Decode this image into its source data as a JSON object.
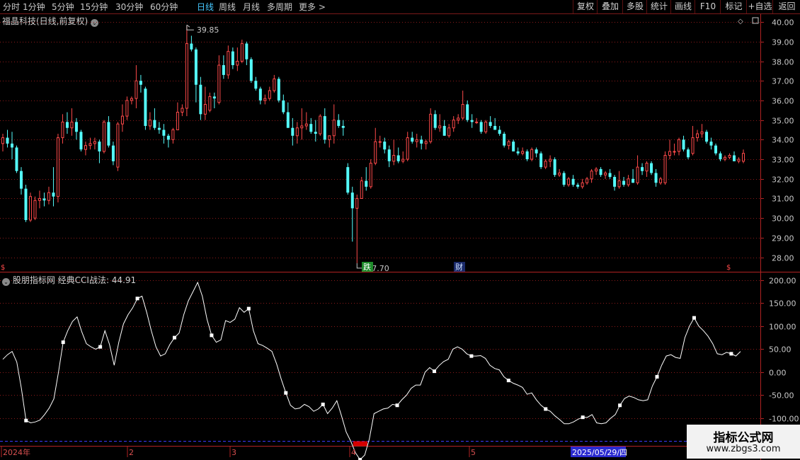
{
  "toolbar": {
    "periods": [
      "分时",
      "1分钟",
      "5分钟",
      "15分钟",
      "30分钟",
      "60分钟",
      "日线",
      "周线",
      "月线",
      "多周期",
      "更多 >"
    ],
    "active_period": "日线",
    "right_buttons": [
      "复权",
      "叠加",
      "多股",
      "统计",
      "画线",
      "F10",
      "标记",
      "+自选",
      "返回"
    ]
  },
  "main": {
    "title": "福晶科技(日线,前复权)",
    "y_ticks": [
      "40.00",
      "39.00",
      "38.00",
      "37.00",
      "36.00",
      "35.00",
      "34.00",
      "33.00",
      "32.00",
      "31.00",
      "30.00",
      "29.00",
      "28.00"
    ],
    "high_label": "39.85",
    "low_label": "27.70",
    "markers": {
      "die": "跌",
      "cai": "财"
    }
  },
  "indicator": {
    "title": "股朋指标网 经典CCI战法: 44.91",
    "y_ticks": [
      "200.00",
      "150.00",
      "100.00",
      "50.00",
      "0.00",
      "-50.00",
      "-100.00"
    ]
  },
  "xaxis": {
    "labels": [
      "2024年",
      "2",
      "3",
      "4",
      "5"
    ],
    "cursor_date": "2025/05/29/四"
  },
  "watermark": {
    "line1": "指标公式网",
    "line2": "www.zbgs3.com"
  },
  "colors": {
    "up": "#ff4a4a",
    "down": "#54fcfc",
    "grid": "#8b1a1a",
    "frame": "#b22222",
    "cci": "#ffffff",
    "signal": "#d40000",
    "ref": "#3a3aff"
  },
  "chart_data": [
    {
      "type": "candlestick",
      "title": "福晶科技(日线,前复权)",
      "ylim": [
        27.3,
        40.4
      ],
      "max_label": 39.85,
      "min_label": 27.7,
      "ohlc": [
        [
          33.8,
          34.3,
          33.4,
          34.1
        ],
        [
          34.1,
          34.5,
          33.6,
          33.8
        ],
        [
          33.8,
          34.4,
          33.0,
          33.6
        ],
        [
          33.6,
          33.7,
          32.3,
          32.4
        ],
        [
          32.4,
          32.6,
          31.2,
          31.5
        ],
        [
          31.5,
          31.7,
          29.8,
          29.9
        ],
        [
          29.9,
          31.3,
          29.8,
          31.1
        ],
        [
          30.0,
          31.1,
          29.9,
          30.9
        ],
        [
          30.9,
          31.4,
          30.5,
          31.0
        ],
        [
          31.0,
          31.3,
          30.6,
          30.9
        ],
        [
          30.9,
          31.6,
          30.7,
          31.3
        ],
        [
          31.3,
          32.6,
          30.6,
          31.1
        ],
        [
          31.1,
          34.3,
          30.8,
          34.1
        ],
        [
          34.1,
          35.3,
          33.8,
          34.9
        ],
        [
          34.9,
          35.4,
          34.3,
          34.6
        ],
        [
          34.6,
          35.6,
          34.2,
          34.9
        ],
        [
          34.9,
          35.1,
          34.0,
          34.4
        ],
        [
          34.4,
          34.5,
          33.4,
          33.5
        ],
        [
          33.5,
          33.9,
          33.2,
          33.7
        ],
        [
          33.7,
          34.1,
          33.5,
          33.8
        ],
        [
          33.8,
          34.1,
          33.5,
          33.9
        ],
        [
          33.9,
          34.0,
          32.8,
          33.4
        ],
        [
          33.4,
          35.0,
          33.3,
          34.9
        ],
        [
          34.9,
          35.2,
          33.6,
          33.7
        ],
        [
          33.7,
          33.9,
          32.7,
          32.9
        ],
        [
          32.6,
          34.9,
          32.4,
          34.8
        ],
        [
          34.8,
          35.8,
          34.4,
          35.2
        ],
        [
          35.2,
          36.2,
          35.0,
          36.0
        ],
        [
          36.0,
          36.2,
          35.8,
          36.1
        ],
        [
          36.1,
          37.8,
          35.6,
          37.0
        ],
        [
          37.0,
          37.3,
          36.4,
          36.8
        ],
        [
          36.6,
          36.7,
          34.5,
          34.7
        ],
        [
          34.7,
          35.4,
          34.5,
          35.0
        ],
        [
          35.0,
          35.6,
          34.5,
          34.6
        ],
        [
          34.6,
          34.9,
          34.3,
          34.5
        ],
        [
          34.5,
          34.8,
          33.8,
          34.2
        ],
        [
          34.2,
          34.3,
          33.6,
          34.0
        ],
        [
          34.0,
          34.6,
          33.8,
          34.5
        ],
        [
          34.5,
          35.9,
          34.5,
          35.4
        ],
        [
          35.4,
          35.8,
          35.2,
          35.6
        ],
        [
          35.6,
          39.8,
          35.2,
          38.9
        ],
        [
          38.9,
          39.3,
          38.5,
          38.6
        ],
        [
          38.6,
          38.7,
          35.9,
          36.8
        ],
        [
          36.8,
          37.2,
          35.0,
          35.3
        ],
        [
          35.3,
          36.7,
          35.0,
          35.8
        ],
        [
          35.5,
          36.4,
          35.4,
          36.2
        ],
        [
          36.2,
          36.4,
          35.6,
          36.1
        ],
        [
          35.9,
          38.3,
          35.8,
          37.8
        ],
        [
          37.8,
          38.3,
          37.1,
          37.3
        ],
        [
          37.3,
          38.8,
          37.1,
          38.5
        ],
        [
          38.5,
          38.7,
          37.6,
          37.8
        ],
        [
          37.8,
          38.7,
          37.5,
          38.0
        ],
        [
          38.0,
          39.1,
          37.9,
          38.9
        ],
        [
          38.9,
          39.0,
          37.8,
          38.1
        ],
        [
          38.1,
          38.2,
          36.9,
          37.0
        ],
        [
          37.0,
          37.2,
          36.5,
          36.6
        ],
        [
          36.6,
          36.7,
          35.8,
          36.0
        ],
        [
          36.0,
          36.3,
          35.8,
          36.1
        ],
        [
          36.1,
          36.7,
          36.0,
          36.5
        ],
        [
          36.5,
          37.3,
          36.4,
          37.1
        ],
        [
          37.1,
          37.2,
          35.9,
          36.0
        ],
        [
          36.0,
          36.3,
          35.3,
          35.4
        ],
        [
          35.4,
          35.9,
          34.6,
          34.6
        ],
        [
          34.6,
          35.1,
          33.7,
          34.2
        ],
        [
          34.2,
          34.9,
          33.8,
          34.6
        ],
        [
          34.6,
          35.6,
          34.0,
          34.7
        ],
        [
          34.7,
          35.4,
          34.5,
          34.8
        ],
        [
          34.8,
          35.1,
          34.3,
          34.4
        ],
        [
          34.4,
          35.0,
          33.9,
          34.3
        ],
        [
          34.3,
          35.3,
          34.2,
          35.2
        ],
        [
          35.2,
          35.6,
          33.8,
          34.0
        ],
        [
          34.0,
          34.1,
          33.6,
          34.2
        ],
        [
          34.2,
          35.8,
          33.8,
          35.0
        ],
        [
          35.0,
          35.3,
          34.6,
          34.7
        ],
        [
          34.7,
          35.0,
          34.2,
          34.6
        ],
        [
          32.6,
          32.8,
          31.2,
          31.3
        ],
        [
          31.3,
          31.6,
          28.8,
          30.5
        ],
        [
          30.5,
          31.2,
          27.7,
          31.0
        ],
        [
          31.0,
          32.1,
          31.0,
          31.9
        ],
        [
          31.9,
          32.6,
          31.4,
          31.6
        ],
        [
          31.6,
          33.0,
          31.5,
          32.8
        ],
        [
          32.8,
          34.6,
          32.7,
          33.9
        ],
        [
          33.9,
          34.2,
          33.6,
          33.9
        ],
        [
          33.9,
          34.1,
          33.3,
          33.5
        ],
        [
          33.5,
          33.7,
          32.6,
          32.9
        ],
        [
          32.9,
          34.0,
          32.7,
          33.2
        ],
        [
          33.2,
          33.6,
          32.8,
          32.9
        ],
        [
          32.9,
          33.4,
          32.8,
          33.0
        ],
        [
          33.0,
          34.4,
          32.9,
          34.1
        ],
        [
          34.1,
          34.4,
          33.8,
          33.9
        ],
        [
          33.9,
          34.3,
          33.6,
          34.0
        ],
        [
          34.0,
          34.2,
          33.5,
          33.8
        ],
        [
          33.8,
          34.0,
          33.5,
          33.9
        ],
        [
          33.9,
          35.6,
          33.8,
          35.3
        ],
        [
          35.3,
          35.5,
          34.5,
          34.6
        ],
        [
          34.6,
          35.3,
          34.4,
          34.7
        ],
        [
          34.7,
          35.0,
          34.2,
          34.2
        ],
        [
          34.2,
          34.8,
          34.1,
          34.6
        ],
        [
          34.6,
          35.2,
          34.4,
          35.0
        ],
        [
          35.0,
          35.3,
          34.8,
          35.1
        ],
        [
          35.1,
          36.5,
          35.0,
          35.8
        ],
        [
          35.8,
          36.0,
          34.9,
          35.0
        ],
        [
          35.0,
          35.3,
          34.6,
          34.9
        ],
        [
          34.9,
          35.1,
          34.8,
          34.9
        ],
        [
          34.9,
          35.0,
          34.3,
          34.4
        ],
        [
          34.4,
          35.0,
          34.3,
          34.9
        ],
        [
          34.9,
          35.2,
          34.6,
          34.7
        ],
        [
          34.7,
          35.1,
          34.5,
          34.5
        ],
        [
          34.5,
          34.7,
          34.2,
          34.3
        ],
        [
          34.3,
          34.4,
          33.6,
          33.7
        ],
        [
          33.7,
          34.0,
          33.5,
          33.9
        ],
        [
          33.9,
          34.0,
          33.4,
          33.4
        ],
        [
          33.4,
          33.6,
          33.2,
          33.3
        ],
        [
          33.3,
          33.6,
          33.2,
          33.4
        ],
        [
          33.4,
          33.5,
          32.9,
          33.0
        ],
        [
          33.0,
          33.6,
          32.9,
          33.5
        ],
        [
          33.5,
          33.6,
          33.1,
          33.3
        ],
        [
          33.3,
          33.4,
          32.5,
          32.6
        ],
        [
          32.6,
          33.0,
          32.5,
          32.9
        ],
        [
          32.9,
          33.2,
          32.6,
          33.0
        ],
        [
          33.0,
          33.1,
          32.1,
          32.2
        ],
        [
          32.2,
          32.5,
          32.1,
          32.3
        ],
        [
          32.3,
          32.4,
          31.6,
          31.7
        ],
        [
          31.7,
          32.1,
          31.6,
          32.0
        ],
        [
          32.0,
          32.2,
          31.6,
          31.7
        ],
        [
          31.7,
          31.8,
          31.5,
          31.6
        ],
        [
          31.6,
          32.0,
          31.5,
          31.8
        ],
        [
          31.8,
          32.1,
          31.7,
          32.0
        ],
        [
          32.0,
          32.5,
          31.8,
          32.4
        ],
        [
          32.4,
          32.6,
          32.2,
          32.5
        ],
        [
          32.5,
          32.6,
          32.1,
          32.2
        ],
        [
          32.2,
          32.4,
          32.0,
          32.3
        ],
        [
          32.3,
          32.5,
          32.0,
          32.1
        ],
        [
          32.1,
          32.2,
          31.4,
          31.6
        ],
        [
          31.6,
          32.4,
          31.5,
          31.9
        ],
        [
          31.9,
          32.1,
          31.6,
          31.7
        ],
        [
          31.7,
          32.2,
          31.6,
          32.0
        ],
        [
          32.0,
          32.5,
          31.8,
          31.8
        ],
        [
          31.8,
          33.2,
          31.7,
          32.6
        ],
        [
          32.6,
          32.8,
          32.2,
          32.4
        ],
        [
          32.4,
          32.9,
          32.1,
          32.8
        ],
        [
          32.8,
          32.9,
          32.2,
          32.3
        ],
        [
          32.3,
          32.5,
          31.6,
          31.8
        ],
        [
          31.8,
          32.1,
          31.7,
          32.0
        ],
        [
          31.8,
          33.4,
          31.7,
          33.2
        ],
        [
          33.2,
          34.0,
          33.0,
          33.4
        ],
        [
          33.4,
          33.8,
          33.2,
          33.4
        ],
        [
          33.4,
          34.1,
          33.2,
          34.0
        ],
        [
          34.0,
          34.2,
          33.4,
          33.5
        ],
        [
          33.5,
          33.6,
          33.0,
          33.1
        ],
        [
          33.3,
          34.7,
          33.2,
          34.1
        ],
        [
          34.1,
          34.5,
          33.9,
          34.3
        ],
        [
          34.3,
          34.8,
          34.1,
          34.4
        ],
        [
          34.4,
          34.5,
          33.8,
          33.9
        ],
        [
          33.9,
          34.1,
          33.5,
          33.7
        ],
        [
          33.7,
          33.8,
          33.2,
          33.3
        ],
        [
          33.3,
          33.4,
          32.9,
          33.0
        ],
        [
          33.0,
          33.2,
          32.9,
          33.1
        ],
        [
          33.1,
          33.3,
          33.0,
          33.2
        ],
        [
          33.2,
          33.4,
          32.9,
          32.9
        ],
        [
          32.9,
          33.1,
          32.8,
          33.0
        ],
        [
          32.9,
          33.5,
          32.8,
          33.3
        ]
      ]
    },
    {
      "type": "line",
      "title": "经典CCI战法",
      "ylim": [
        -160,
        215
      ],
      "last_value": 44.91,
      "reference_level": -150,
      "signal_ranges": [
        [
          84,
          90
        ]
      ],
      "values": [
        28,
        38,
        45,
        22,
        -35,
        -105,
        -110,
        -108,
        -104,
        -92,
        -78,
        -58,
        0,
        65,
        90,
        110,
        120,
        88,
        62,
        55,
        50,
        55,
        90,
        60,
        15,
        65,
        105,
        125,
        140,
        160,
        165,
        130,
        90,
        55,
        35,
        40,
        60,
        75,
        85,
        125,
        155,
        175,
        195,
        165,
        115,
        80,
        65,
        70,
        112,
        108,
        115,
        140,
        130,
        138,
        90,
        62,
        58,
        52,
        45,
        18,
        -15,
        -45,
        -72,
        -80,
        -78,
        -70,
        -75,
        -85,
        -80,
        -70,
        -90,
        -78,
        -62,
        -95,
        -130,
        -150,
        -175,
        -190,
        -180,
        -145,
        -90,
        -85,
        -80,
        -78,
        -70,
        -72,
        -60,
        -50,
        -35,
        -28,
        -28,
        0,
        10,
        2,
        14,
        23,
        28,
        50,
        55,
        50,
        40,
        35,
        35,
        36,
        30,
        15,
        8,
        5,
        -10,
        -18,
        -24,
        -28,
        -33,
        -48,
        -45,
        -60,
        -72,
        -80,
        -85,
        -95,
        -103,
        -112,
        -112,
        -108,
        -102,
        -98,
        -98,
        -92,
        -110,
        -112,
        -110,
        -100,
        -92,
        -72,
        -57,
        -52,
        -55,
        -60,
        -62,
        -60,
        -30,
        -10,
        15,
        35,
        38,
        32,
        30,
        75,
        100,
        118,
        100,
        90,
        78,
        62,
        40,
        38,
        43,
        40,
        35,
        45
      ]
    }
  ]
}
